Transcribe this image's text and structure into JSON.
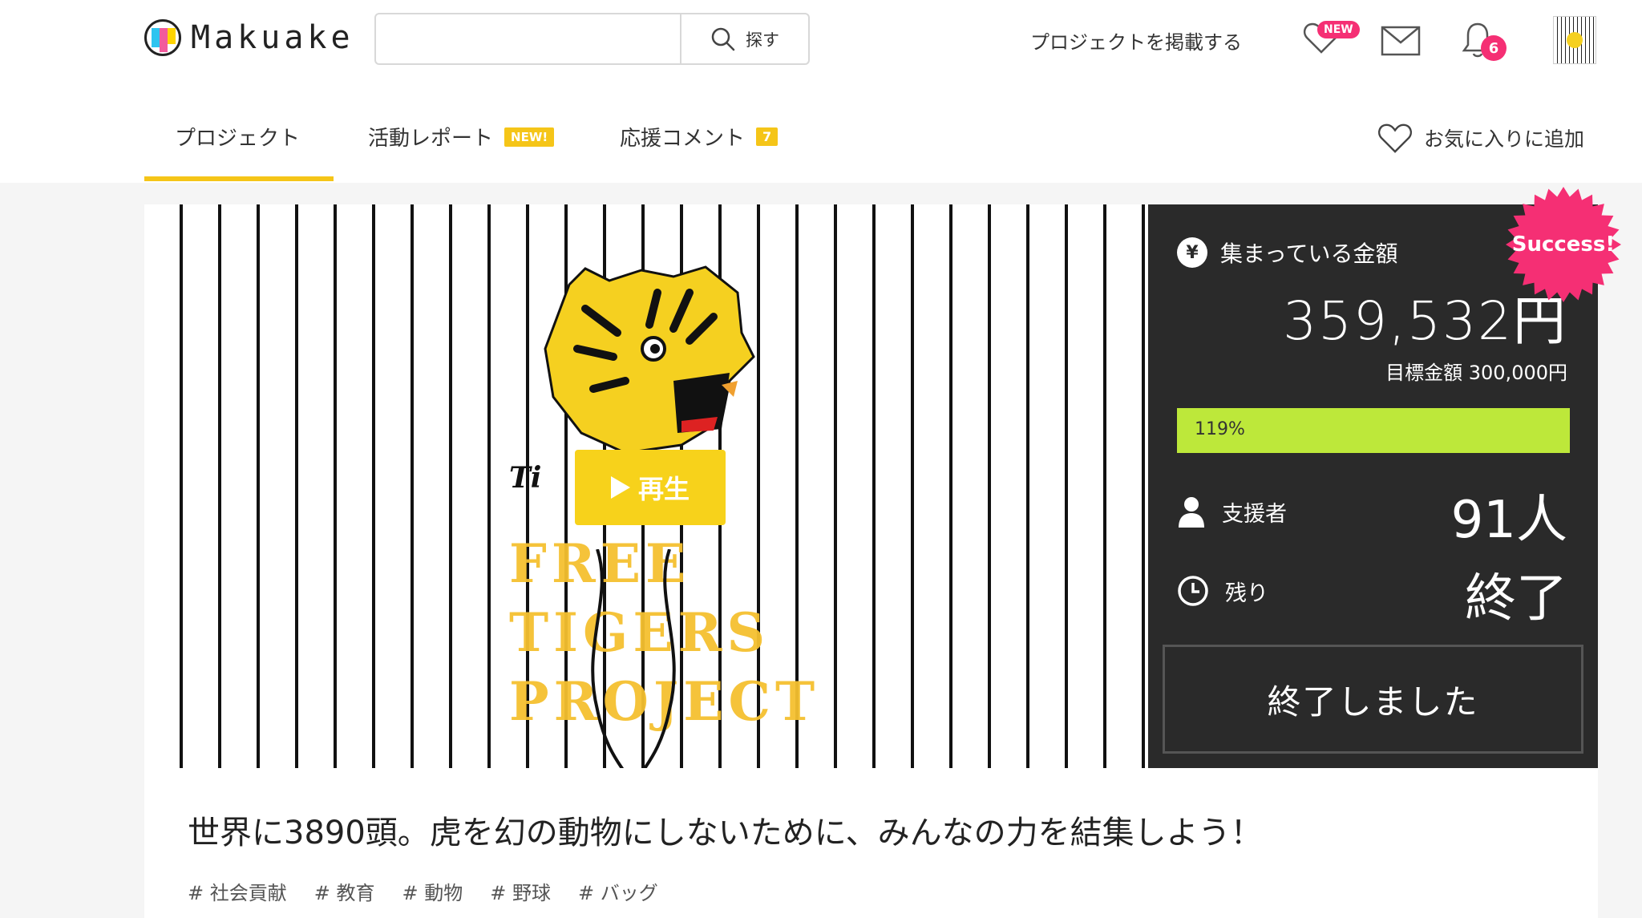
{
  "header": {
    "logo_text": "Makuake",
    "search_placeholder": "",
    "search_button": "探す",
    "post_project": "プロジェクトを掲載する",
    "favorites_badge": "NEW",
    "notifications_count": "6"
  },
  "tabs": [
    {
      "label": "プロジェクト",
      "active": true
    },
    {
      "label": "活動レポート",
      "badge": "NEW!"
    },
    {
      "label": "応援コメント",
      "badge": "7"
    }
  ],
  "favorite_add": "お気に入りに追加",
  "hero": {
    "play_label": "再生",
    "overlay_text_1": "FREE",
    "overlay_text_2": "TIGERS",
    "overlay_text_3": "PROJECT",
    "partial_text": "Ti"
  },
  "stats": {
    "success_badge": "Success!",
    "raised_label": "集まっている金額",
    "raised_amount": "359,532円",
    "goal_text": "目標金額 300,000円",
    "progress_percent": 119,
    "progress_label": "119%",
    "supporters_label": "支援者",
    "supporters_value": "91人",
    "remaining_label": "残り",
    "remaining_value": "終了",
    "ended_button": "終了しました"
  },
  "project_title": "世界に3890頭。虎を幻の動物にしないために、みんなの力を結集しよう！",
  "tags": [
    "# 社会貢献",
    "# 教育",
    "# 動物",
    "# 野球",
    "# バッグ"
  ],
  "colors": {
    "accent": "#f5c518",
    "badge_pink": "#f52f74",
    "progress": "#bde83a",
    "panel": "#2a2a2a"
  }
}
